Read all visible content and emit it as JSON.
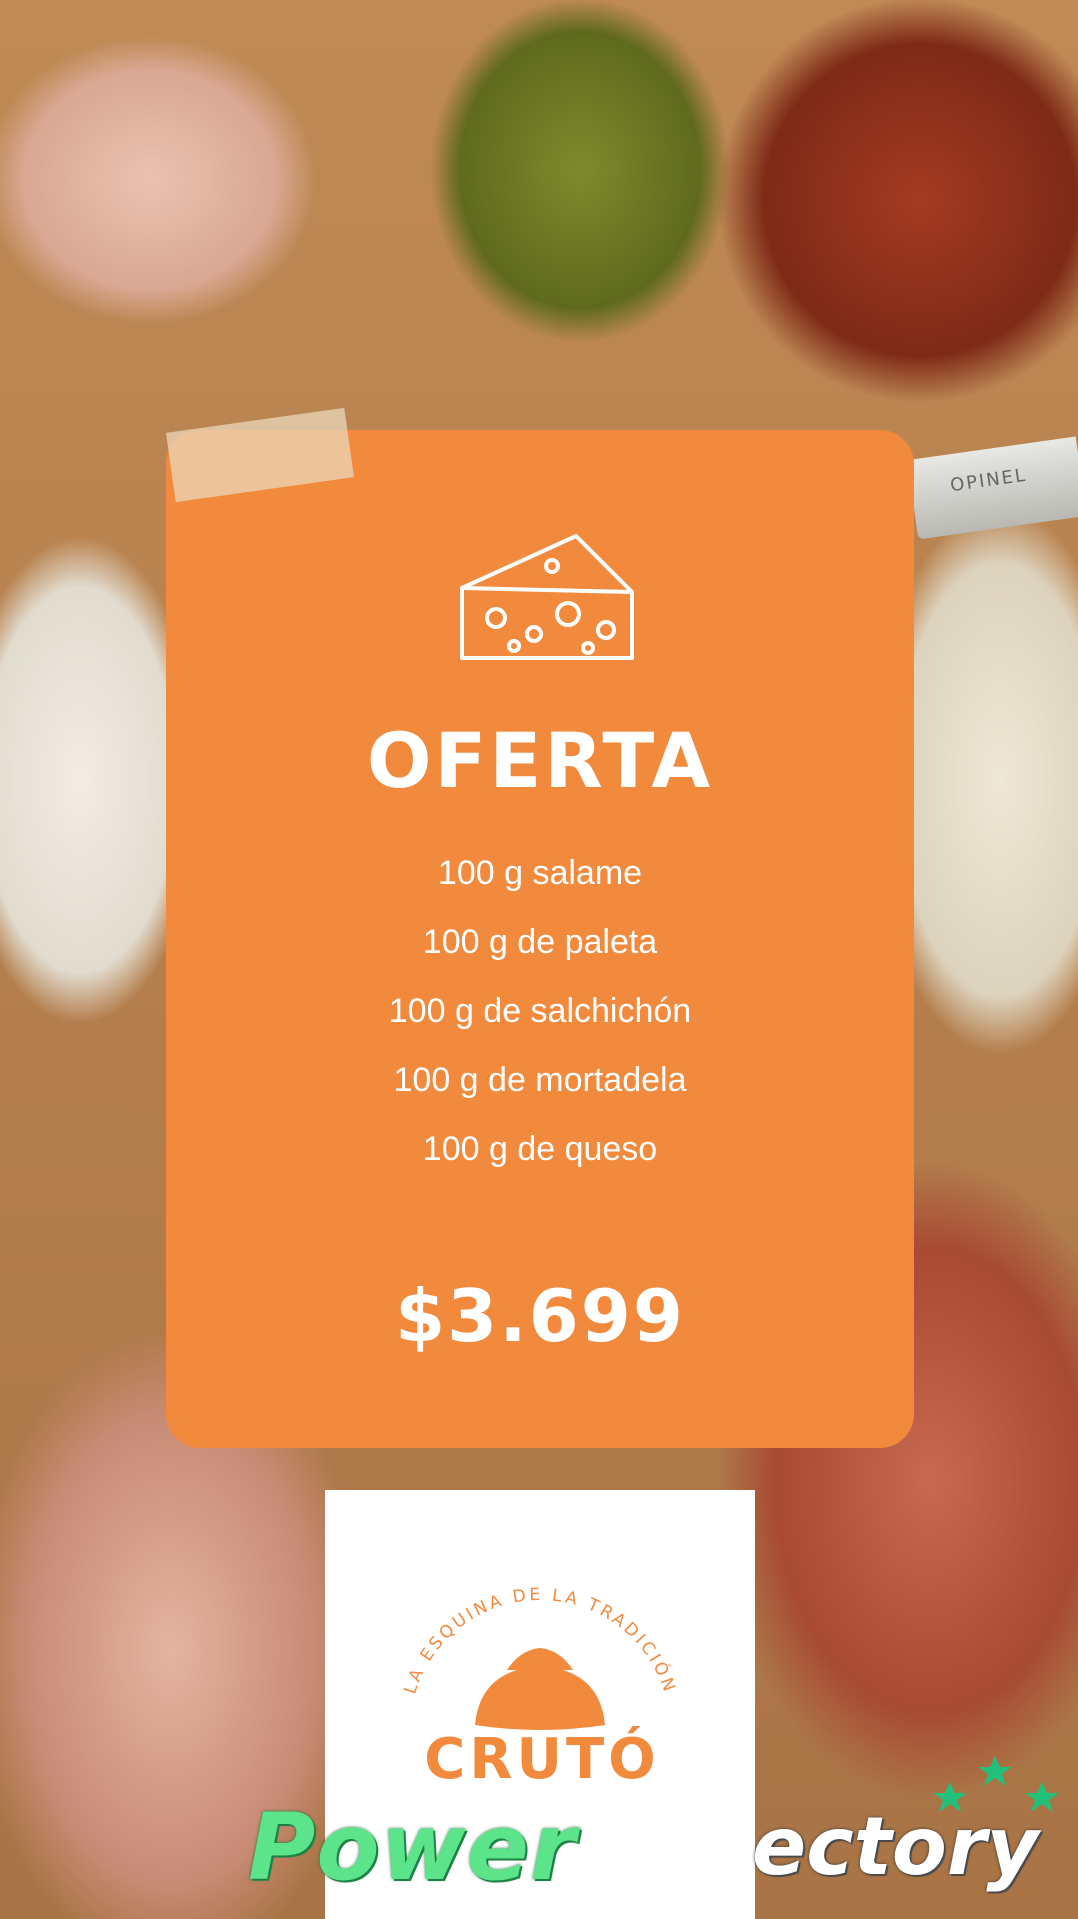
{
  "offer": {
    "title": "OFERTA",
    "items": [
      "100 g salame",
      "100 g de paleta",
      "100 g de salchichón",
      "100 g de mortadela",
      "100 g de queso"
    ],
    "price": "$3.699"
  },
  "logo": {
    "tagline": "LA ESQUINA DE LA TRADICIÓN",
    "brand": "CRUTÓ"
  },
  "watermark": {
    "left": "Power",
    "right": "ectory"
  },
  "knife_engraving": "OPINEL",
  "colors": {
    "card": "#f28a3d",
    "text": "#ffffff",
    "watermark_green": "#5be48a"
  },
  "icons": [
    "cheese-icon",
    "croissant-icon",
    "star-icon"
  ]
}
